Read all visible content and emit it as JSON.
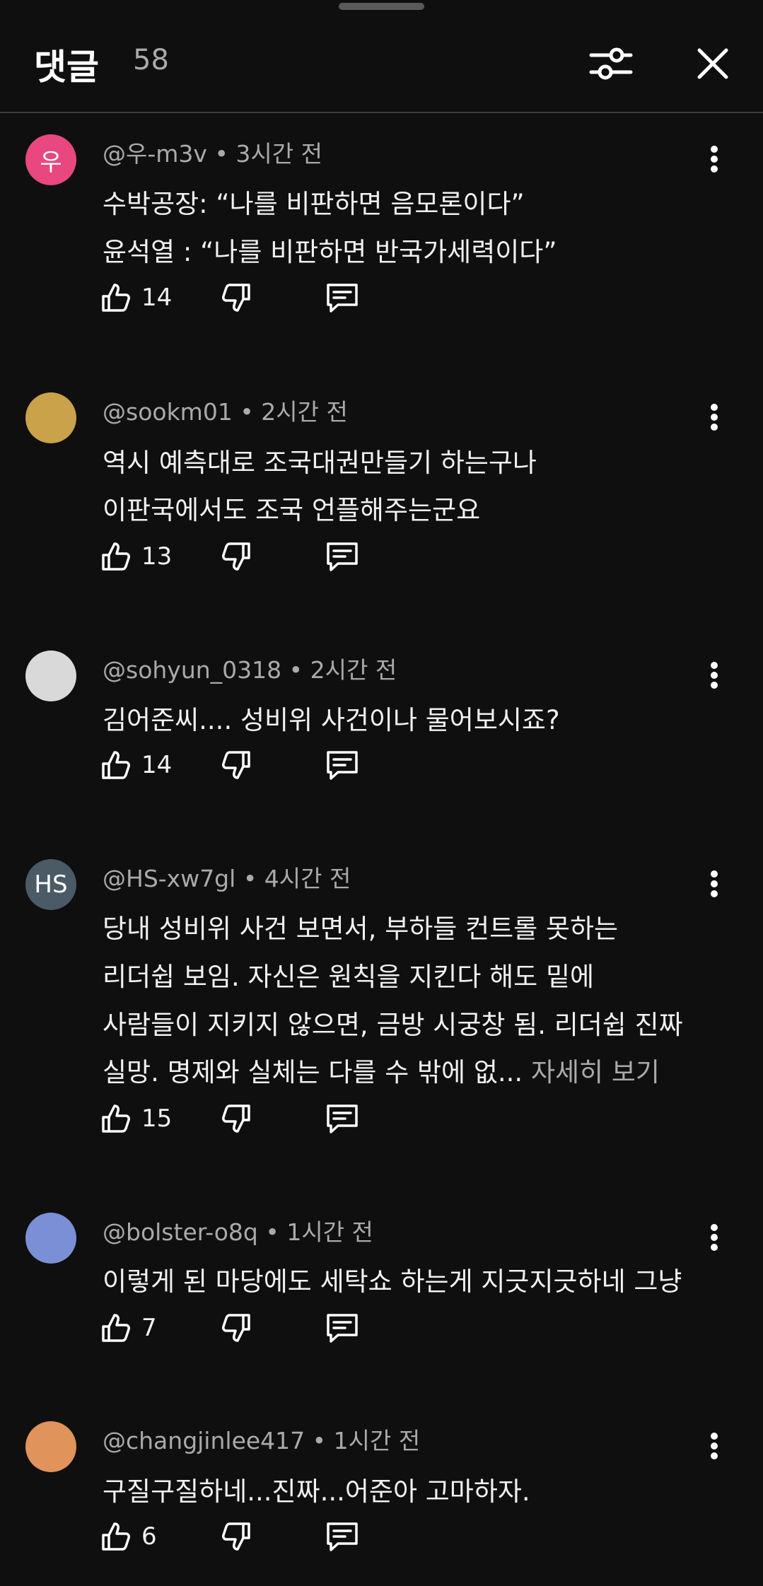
{
  "header": {
    "title": "댓글",
    "count": "58"
  },
  "comments": [
    {
      "author": "@우-m3v",
      "time": "3시간 전",
      "avatar_text": "우",
      "avatar_color": "#e8487f",
      "lines": [
        "수박공장: “나를 비판하면 음모론이다”",
        "윤석열 : “나를 비판하면 반국가세력이다”"
      ],
      "likes": "14"
    },
    {
      "author": "@sookm01",
      "time": "2시간 전",
      "avatar_color": "#c9a24a",
      "lines": [
        "역시  예측대로 조국대권만들기  하는구나",
        "이판국에서도 조국 언플해주는군요"
      ],
      "likes": "13"
    },
    {
      "author": "@sohyun_0318",
      "time": "2시간 전",
      "avatar_color": "#d9d9d9",
      "lines": [
        "김어준씨.... 성비위 사건이나 물어보시죠?"
      ],
      "likes": "14"
    },
    {
      "author": "@HS-xw7gl",
      "time": "4시간 전",
      "avatar_text": "HS",
      "avatar_color": "#4a5a66",
      "lines": [
        "당내 성비위 사건 보면서, 부하들 컨트롤 못하는",
        "리더쉽 보임. 자신은 원칙을 지킨다 해도 밑에",
        "사람들이 지키지 않으면, 금방 시궁창 됨. 리더쉽 진짜",
        "실망. 명제와 실체는 다를 수 밖에 없..."
      ],
      "see_more": "자세히 보기",
      "likes": "15"
    },
    {
      "author": "@bolster-o8q",
      "time": "1시간 전",
      "avatar_color": "#7b8fd6",
      "lines": [
        "이렇게 된 마당에도 세탁쇼 하는게 지긋지긋하네 그냥"
      ],
      "likes": "7"
    },
    {
      "author": "@changjinlee417",
      "time": "1시간 전",
      "avatar_color": "#e0935a",
      "lines": [
        "구질구질하네...진짜...어준아 고마하자."
      ],
      "likes": "6"
    }
  ],
  "meta_separator": "•",
  "icons": {
    "filter": "sliders-icon",
    "close": "close-icon",
    "more": "more-vertical-icon",
    "like": "thumbs-up-icon",
    "dislike": "thumbs-down-icon",
    "reply": "reply-comment-icon"
  },
  "colors": {
    "background": "#0f0f0f",
    "text": "#f1f1f1",
    "secondary": "#aaaaaa"
  }
}
